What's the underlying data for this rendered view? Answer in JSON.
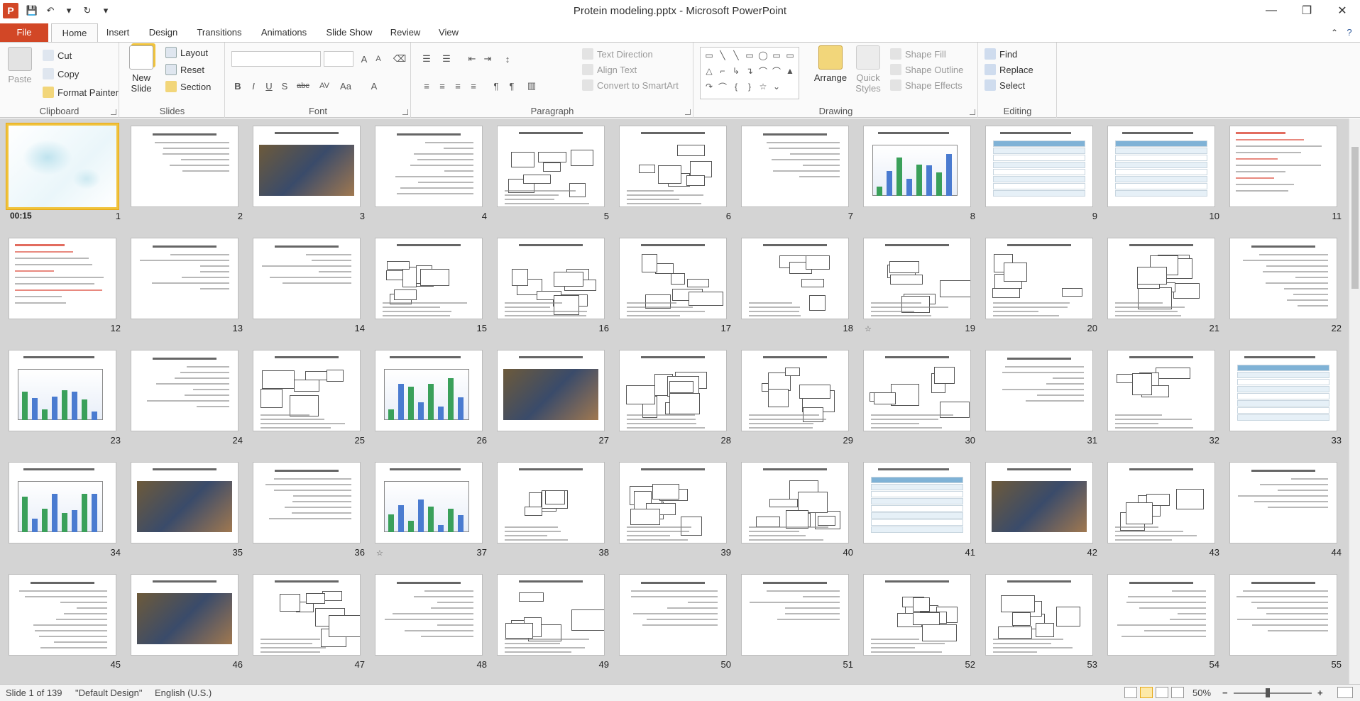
{
  "window": {
    "title": "Protein modeling.pptx  -  Microsoft PowerPoint",
    "app_icon": "P"
  },
  "qat": [
    {
      "name": "save-icon",
      "glyph": "💾"
    },
    {
      "name": "undo-icon",
      "glyph": "↶"
    },
    {
      "name": "undo-dropdown-icon",
      "glyph": "▾"
    },
    {
      "name": "redo-icon",
      "glyph": "↻"
    },
    {
      "name": "customize-qat-icon",
      "glyph": "▾"
    }
  ],
  "window_controls": {
    "minimize": "—",
    "restore": "❐",
    "close": "✕"
  },
  "tabs": [
    "File",
    "Home",
    "Insert",
    "Design",
    "Transitions",
    "Animations",
    "Slide Show",
    "Review",
    "View"
  ],
  "active_tab": "Home",
  "ribbon": {
    "clipboard": {
      "label": "Clipboard",
      "paste": "Paste",
      "cut": "Cut",
      "copy": "Copy",
      "format_painter": "Format Painter"
    },
    "slides": {
      "label": "Slides",
      "new_slide": "New Slide",
      "layout": "Layout",
      "reset": "Reset",
      "section": "Section"
    },
    "font": {
      "label": "Font",
      "font_name": "",
      "font_size": "",
      "buttons": [
        "B",
        "I",
        "U",
        "S",
        "abc",
        "AV",
        "Aa",
        "A"
      ]
    },
    "paragraph": {
      "label": "Paragraph",
      "text_direction": "Text Direction",
      "align_text": "Align Text",
      "convert_smartart": "Convert to SmartArt"
    },
    "drawing": {
      "label": "Drawing",
      "arrange": "Arrange",
      "quick_styles": "Quick Styles",
      "shape_fill": "Shape Fill",
      "shape_outline": "Shape Outline",
      "shape_effects": "Shape Effects"
    },
    "editing": {
      "label": "Editing",
      "find": "Find",
      "replace": "Replace",
      "select": "Select"
    }
  },
  "slides": [
    {
      "n": "1",
      "timing": "00:15",
      "selected": true,
      "style": "wallpaper"
    },
    {
      "n": "2",
      "style": "text"
    },
    {
      "n": "3",
      "style": "photo"
    },
    {
      "n": "4",
      "style": "text"
    },
    {
      "n": "5",
      "style": "diagram"
    },
    {
      "n": "6",
      "style": "diagram"
    },
    {
      "n": "7",
      "style": "text"
    },
    {
      "n": "8",
      "style": "chart"
    },
    {
      "n": "9",
      "style": "table"
    },
    {
      "n": "10",
      "style": "table"
    },
    {
      "n": "11",
      "style": "redtext"
    },
    {
      "n": "12",
      "style": "redtext"
    },
    {
      "n": "13",
      "style": "text"
    },
    {
      "n": "14",
      "style": "text"
    },
    {
      "n": "15",
      "style": "diagram"
    },
    {
      "n": "16",
      "style": "diagram"
    },
    {
      "n": "17",
      "style": "diagram"
    },
    {
      "n": "18",
      "style": "diagram"
    },
    {
      "n": "19",
      "style": "diagram",
      "anim": true
    },
    {
      "n": "20",
      "style": "diagram"
    },
    {
      "n": "21",
      "style": "diagram"
    },
    {
      "n": "22",
      "style": "text"
    },
    {
      "n": "23",
      "style": "chart"
    },
    {
      "n": "24",
      "style": "text"
    },
    {
      "n": "25",
      "style": "diagram"
    },
    {
      "n": "26",
      "style": "chart"
    },
    {
      "n": "27",
      "style": "photo"
    },
    {
      "n": "28",
      "style": "diagram"
    },
    {
      "n": "29",
      "style": "diagram"
    },
    {
      "n": "30",
      "style": "diagram"
    },
    {
      "n": "31",
      "style": "text"
    },
    {
      "n": "32",
      "style": "diagram"
    },
    {
      "n": "33",
      "style": "table"
    },
    {
      "n": "34",
      "style": "chart"
    },
    {
      "n": "35",
      "style": "photo"
    },
    {
      "n": "36",
      "style": "text"
    },
    {
      "n": "37",
      "style": "chart",
      "anim": true
    },
    {
      "n": "38",
      "style": "diagram"
    },
    {
      "n": "39",
      "style": "diagram"
    },
    {
      "n": "40",
      "style": "diagram"
    },
    {
      "n": "41",
      "style": "table"
    },
    {
      "n": "42",
      "style": "photo"
    },
    {
      "n": "43",
      "style": "diagram"
    },
    {
      "n": "44",
      "style": "text"
    },
    {
      "n": "45",
      "style": "text"
    },
    {
      "n": "46",
      "style": "photo"
    },
    {
      "n": "47",
      "style": "diagram"
    },
    {
      "n": "48",
      "style": "text"
    },
    {
      "n": "49",
      "style": "diagram"
    },
    {
      "n": "50",
      "style": "text"
    },
    {
      "n": "51",
      "style": "text"
    },
    {
      "n": "52",
      "style": "diagram"
    },
    {
      "n": "53",
      "style": "diagram"
    },
    {
      "n": "54",
      "style": "text"
    },
    {
      "n": "55",
      "style": "text"
    }
  ],
  "status": {
    "slide": "Slide 1 of 139",
    "theme": "\"Default Design\"",
    "language": "English (U.S.)",
    "zoom": "50%",
    "zoom_out": "−",
    "zoom_in": "+"
  },
  "colors": {
    "accent": "#d24726",
    "selection": "#f0c33c",
    "sorter_bg": "#d4d4d4"
  }
}
